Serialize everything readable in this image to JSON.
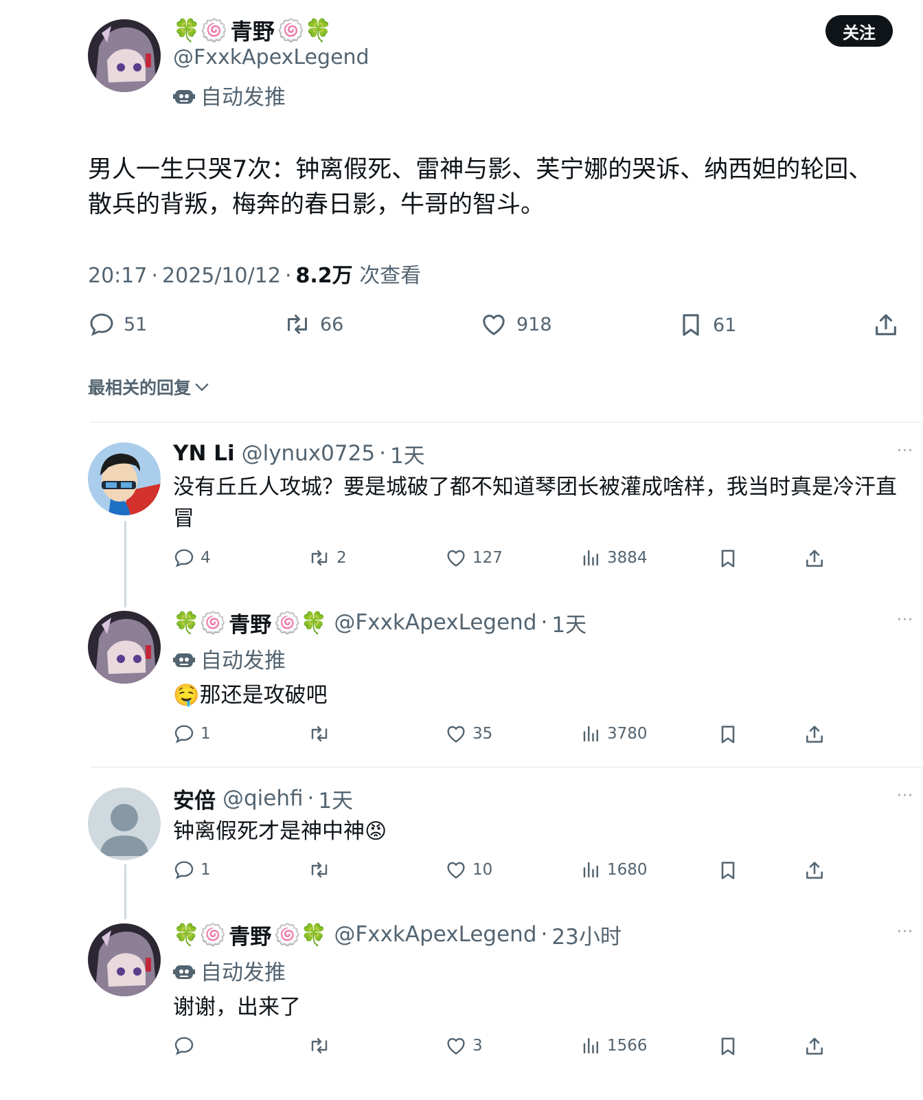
{
  "tweet": {
    "emoji_left": "🍀🍥",
    "display_name": "青野",
    "emoji_right": "🍥🍀",
    "handle": "@FxxkApexLegend",
    "bot_label": "自动发推",
    "follow_label": "关注",
    "text": "男人一生只哭7次：钟离假死、雷神与影、芙宁娜的哭诉、纳西妲的轮回、散兵的背叛，梅奔的春日影，牛哥的智斗。",
    "time": "20:17",
    "date": "2025/10/12",
    "views": "8.2万",
    "views_label": "次查看",
    "replies": "51",
    "retweets": "66",
    "likes": "918",
    "bookmarks": "61"
  },
  "sort_label": "最相关的回复",
  "replies": [
    {
      "display_name": "YN Li",
      "handle": "@lynux0725",
      "time": "1天",
      "text": "没有丘丘人攻城？要是城破了都不知道琴团长被灌成啥样，我当时真是冷汗直冒",
      "replies": "4",
      "retweets": "2",
      "likes": "127",
      "views": "3884"
    },
    {
      "emoji_left": "🍀🍥",
      "display_name": "青野",
      "emoji_right": "🍥🍀",
      "handle": "@FxxkApexLegend",
      "time": "1天",
      "bot_label": "自动发推",
      "emoji": "🤤",
      "text": "那还是攻破吧",
      "replies": "1",
      "retweets": "",
      "likes": "35",
      "views": "3780"
    },
    {
      "display_name": "安倍",
      "handle": "@qiehfi",
      "time": "1天",
      "text": "钟离假死才是神中神",
      "emoji": "😡",
      "replies": "1",
      "retweets": "",
      "likes": "10",
      "views": "1680"
    },
    {
      "emoji_left": "🍀🍥",
      "display_name": "青野",
      "emoji_right": "🍥🍀",
      "handle": "@FxxkApexLegend",
      "time": "23小时",
      "bot_label": "自动发推",
      "text": "谢谢，出来了",
      "replies": "",
      "retweets": "",
      "likes": "3",
      "views": "1566"
    }
  ],
  "more_label": "···",
  "colors": {
    "text": "#0f1419",
    "secondary": "#536471",
    "divider": "#e1e5e8",
    "follow_bg": "#0f1419"
  }
}
